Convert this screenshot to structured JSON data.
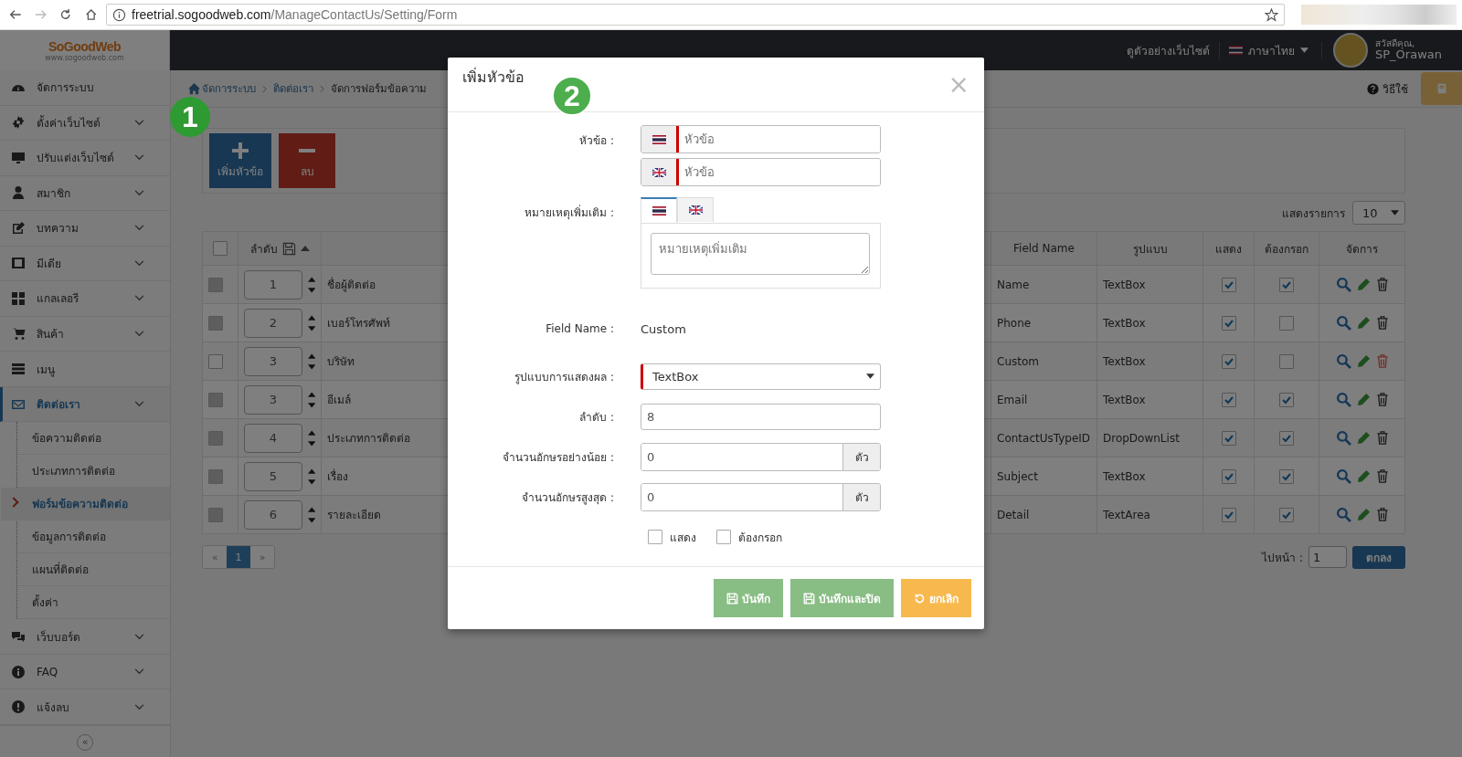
{
  "browser": {
    "url_host": "freetrial.sogoodweb.com",
    "url_path": "/ManageContactUs/Setting/Form"
  },
  "header": {
    "logo": "SoGoodWeb",
    "logo_sub": "www.sogoodweb.com",
    "preview_link": "ดูตัวอย่างเว็บไซต์",
    "language": "ภาษาไทย",
    "greeting": "สวัสดีคุณ,",
    "username": "SP_Orawan"
  },
  "sidebar": {
    "items": [
      {
        "label": "จัดการระบบ",
        "has_submenu": false,
        "selected": false
      },
      {
        "label": "ตั้งค่าเว็บไซต์",
        "has_submenu": true,
        "selected": false
      },
      {
        "label": "ปรับแต่งเว็บไซต์",
        "has_submenu": true,
        "selected": false
      },
      {
        "label": "สมาชิก",
        "has_submenu": true,
        "selected": false
      },
      {
        "label": "บทความ",
        "has_submenu": true,
        "selected": false
      },
      {
        "label": "มีเดีย",
        "has_submenu": true,
        "selected": false
      },
      {
        "label": "แกลเลอรี",
        "has_submenu": true,
        "selected": false
      },
      {
        "label": "สินค้า",
        "has_submenu": true,
        "selected": false
      },
      {
        "label": "เมนู",
        "has_submenu": false,
        "selected": false
      },
      {
        "label": "ติดต่อเรา",
        "has_submenu": true,
        "selected": true,
        "children": [
          {
            "label": "ข้อความติดต่อ",
            "selected": false
          },
          {
            "label": "ประเภทการติดต่อ",
            "selected": false
          },
          {
            "label": "ฟอร์มข้อความติดต่อ",
            "selected": true
          },
          {
            "label": "ข้อมูลการติดต่อ",
            "selected": false
          },
          {
            "label": "แผนที่ติดต่อ",
            "selected": false
          },
          {
            "label": "ตั้งค่า",
            "selected": false
          }
        ]
      },
      {
        "label": "เว็บบอร์ด",
        "has_submenu": true,
        "selected": false
      },
      {
        "label": "FAQ",
        "has_submenu": true,
        "selected": false
      },
      {
        "label": "แจ้งลบ",
        "has_submenu": true,
        "selected": false
      }
    ],
    "collapse": "«"
  },
  "breadcrumb": [
    "จัดการระบบ",
    "ติดต่อเรา",
    "จัดการฟอร์มข้อความ"
  ],
  "help": "วิธีใช้",
  "toolbar": {
    "add_button": "เพิ่มหัวข้อ",
    "delete_button": "ลบ"
  },
  "page_size": {
    "label": "แสดงรายการ",
    "value": "10"
  },
  "table": {
    "select_all_checked": false,
    "columns": [
      "ลำดับ",
      "Field Name",
      "รูปแบบ",
      "แสดง",
      "ต้องกรอก",
      "จัดการ"
    ],
    "rows": [
      {
        "order": "1",
        "title": "ชื่อผู้ติดต่อ",
        "field": "Name",
        "type": "TextBox",
        "show": true,
        "required": true,
        "disabled": true,
        "deletable": false
      },
      {
        "order": "2",
        "title": "เบอร์โทรศัพท์",
        "field": "Phone",
        "type": "TextBox",
        "show": true,
        "required": false,
        "disabled": true,
        "deletable": false
      },
      {
        "order": "3",
        "title": "บริษัท",
        "field": "Custom",
        "type": "TextBox",
        "show": true,
        "required": false,
        "disabled": false,
        "deletable": true
      },
      {
        "order": "3",
        "title": "อีเมล์",
        "field": "Email",
        "type": "TextBox",
        "show": true,
        "required": true,
        "disabled": true,
        "deletable": false
      },
      {
        "order": "4",
        "title": "ประเภทการติดต่อ",
        "field": "ContactUsTypeID",
        "type": "DropDownList",
        "show": true,
        "required": true,
        "disabled": true,
        "deletable": false
      },
      {
        "order": "5",
        "title": "เรื่อง",
        "field": "Subject",
        "type": "TextBox",
        "show": true,
        "required": true,
        "disabled": true,
        "deletable": false
      },
      {
        "order": "6",
        "title": "รายละเอียด",
        "field": "Detail",
        "type": "TextArea",
        "show": true,
        "required": true,
        "disabled": true,
        "deletable": false
      }
    ]
  },
  "pagination": {
    "prev": "«",
    "pages": [
      {
        "label": "1",
        "selected": true
      }
    ],
    "next": "»",
    "goto_label": "ไปหน้า :",
    "goto_value": "1",
    "goto_button": "ตกลง"
  },
  "modal": {
    "title": "เพิ่มหัวข้อ",
    "close": "×",
    "title_label": "หัวข้อ :",
    "title_inputs": [
      {
        "placeholder": "หัวข้อ"
      },
      {
        "placeholder": "หัวข้อ"
      }
    ],
    "note_label": "หมายเหตุเพิ่มเติม :",
    "note_tabs": [
      {
        "selected": true
      },
      {
        "selected": false
      }
    ],
    "note_placeholder": "หมายเหตุเพิ่มเติม",
    "field_name_label": "Field Name :",
    "field_name": "Custom",
    "display_label": "รูปแบบการแสดงผล :",
    "display_value": "TextBox",
    "order_label": "ลำดับ :",
    "order_value": "8",
    "min_label": "จำนวนอักษรอย่างน้อย :",
    "min_value": "0",
    "min_unit": "ตัว",
    "max_label": "จำนวนอักษรสูงสุด :",
    "max_value": "0",
    "max_unit": "ตัว",
    "checks": [
      {
        "label": "แสดง",
        "checked": false
      },
      {
        "label": "ต้องกรอก",
        "checked": false
      }
    ],
    "buttons": [
      {
        "label": "บันทึก",
        "kind": "save"
      },
      {
        "label": "บันทึกและปิด",
        "kind": "save"
      },
      {
        "label": "ยกเลิก",
        "kind": "cancel"
      }
    ]
  },
  "annotations": [
    {
      "label": "1"
    },
    {
      "label": "2"
    }
  ]
}
